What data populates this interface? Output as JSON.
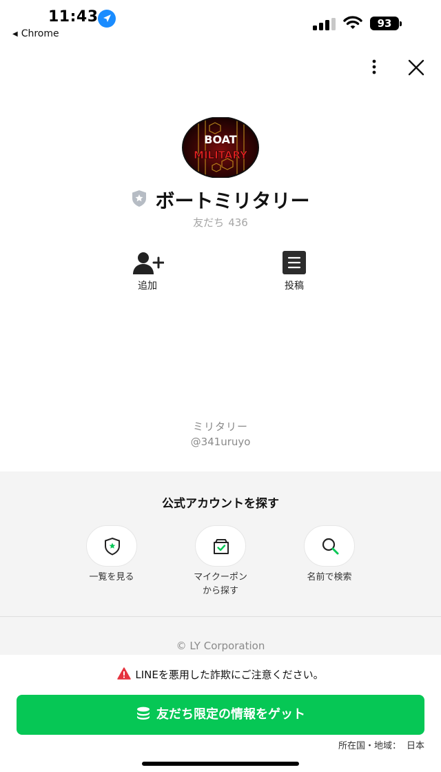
{
  "status_bar": {
    "time": "11:43",
    "back_app": "Chrome",
    "battery": "93",
    "location_icon": "location-arrow-icon",
    "signal_icon": "cellular-signal-icon",
    "wifi_icon": "wifi-icon"
  },
  "header": {
    "more_icon": "more-vertical-icon",
    "close_icon": "close-icon"
  },
  "profile": {
    "avatar_text_top": "BOAT",
    "avatar_text_bottom": "MILITARY",
    "badge_icon": "verified-shield-icon",
    "name": "ボートミリタリー",
    "friends_label": "友だち",
    "friends_count": "436",
    "actions": [
      {
        "label": "追加",
        "icon": "add-friend-icon"
      },
      {
        "label": "投稿",
        "icon": "posts-icon"
      }
    ],
    "sub_name": "ミリタリー",
    "account_id": "@341uruyo"
  },
  "explore": {
    "title": "公式アカウントを探す",
    "items": [
      {
        "label": "一覧を見る",
        "icon": "shield-star-icon"
      },
      {
        "label_line1": "マイクーポン",
        "label_line2": "から探す",
        "icon": "coupon-box-icon"
      },
      {
        "label": "名前で検索",
        "icon": "search-icon"
      }
    ],
    "copyright": "© LY Corporation"
  },
  "footer": {
    "warning": "LINEを悪用した詐欺にご注意ください。",
    "cta_label": "友だち限定の情報をゲット",
    "region_label": "所在国・地域：",
    "region_value": "日本"
  },
  "colors": {
    "line_green": "#06c755",
    "warning_red": "#e5333f",
    "muted_text": "#8a8a8a",
    "section_bg": "#f4f4f4"
  }
}
